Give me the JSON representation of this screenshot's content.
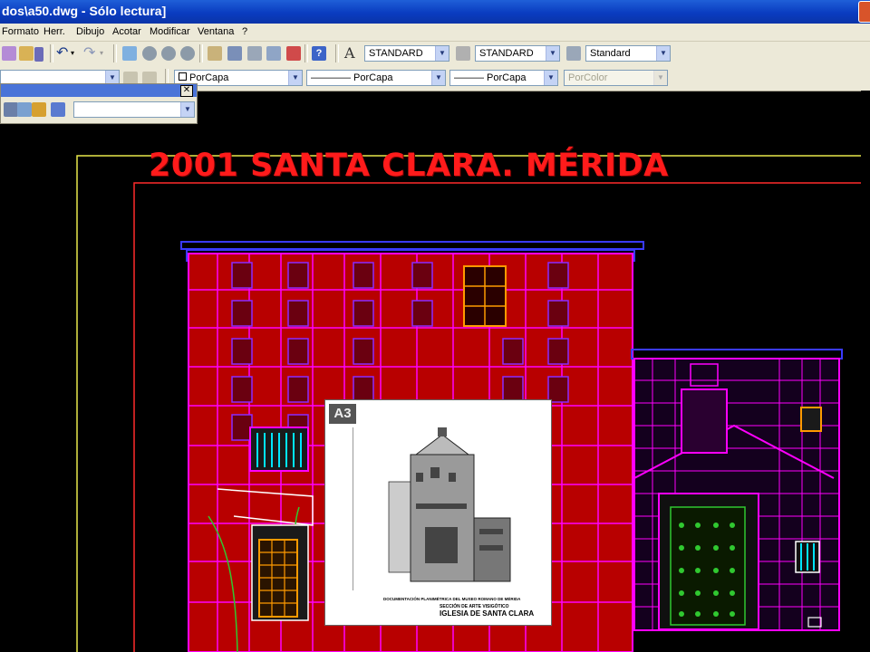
{
  "window": {
    "title": "dos\\a50.dwg - Sólo lectura]"
  },
  "menu": [
    "Formato",
    "Herr.",
    "Dibujo",
    "Acotar",
    "Modificar",
    "Ventana",
    "?"
  ],
  "styles": {
    "text_style": "STANDARD",
    "dim_style": "STANDARD",
    "table_style": "Standard"
  },
  "properties": {
    "color": "PorCapa",
    "linetype": "———— PorCapa",
    "lineweight": "——— PorCapa",
    "plotstyle": "PorColor"
  },
  "palette": {
    "close_label": "✕",
    "value": ""
  },
  "drawing": {
    "title": "2001 SANTA CLARA. MÉRIDA",
    "colors": {
      "title": "#ff1b1b",
      "wall": "#ff00ff",
      "stone": "#ff2a2a",
      "cornice": "#3a3aff",
      "window": "#00e5ff",
      "door": "#ff9a00",
      "vegetation": "#30c830"
    }
  },
  "sheet": {
    "size_label": "A3",
    "caption_line1": "DOCUMENTACIÓN PLANIMÉTRICA DEL MUSEO ROMANO DE MÉRIDA",
    "caption_line2": "SECCIÓN DE ARTE VISIGÓTICO",
    "caption_line3": "IGLESIA DE SANTA CLARA"
  }
}
